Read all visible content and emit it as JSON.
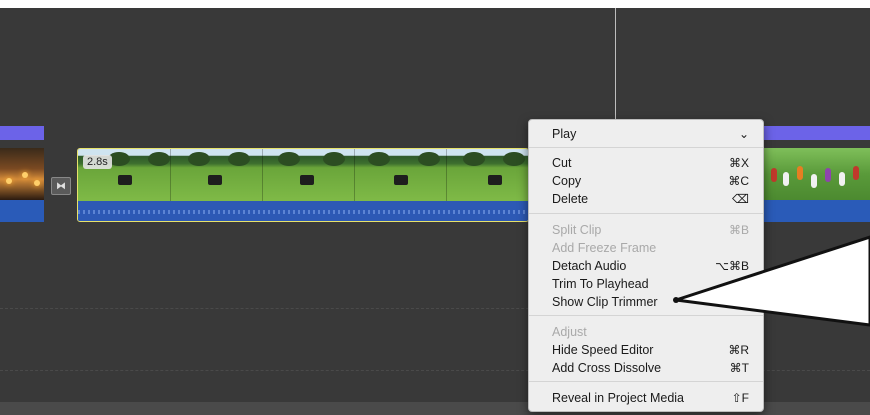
{
  "timeline": {
    "clip_duration": "2.8s",
    "transition_icon": "transition-icon"
  },
  "context_menu": {
    "items": [
      {
        "label": "Play",
        "shortcut": "⌄",
        "enabled": true
      },
      {
        "label": "Cut",
        "shortcut": "⌘X",
        "enabled": true
      },
      {
        "label": "Copy",
        "shortcut": "⌘C",
        "enabled": true
      },
      {
        "label": "Delete",
        "shortcut": "⌫",
        "enabled": true
      },
      {
        "label": "Split Clip",
        "shortcut": "⌘B",
        "enabled": false
      },
      {
        "label": "Add Freeze Frame",
        "shortcut": "",
        "enabled": false
      },
      {
        "label": "Detach Audio",
        "shortcut": "⌥⌘B",
        "enabled": true
      },
      {
        "label": "Trim To Playhead",
        "shortcut": "⌥/",
        "enabled": true
      },
      {
        "label": "Show Clip Trimmer",
        "shortcut": "⌘\\",
        "enabled": true
      },
      {
        "label": "Adjust",
        "shortcut": "",
        "enabled": false
      },
      {
        "label": "Hide Speed Editor",
        "shortcut": "⌘R",
        "enabled": true
      },
      {
        "label": "Add Cross Dissolve",
        "shortcut": "⌘T",
        "enabled": true
      },
      {
        "label": "Reveal in Project Media",
        "shortcut": "⇧F",
        "enabled": true
      }
    ]
  },
  "colors": {
    "timeline_bg": "#393939",
    "clip_border": "#e7e26a",
    "audio_band": "#2d59b5",
    "title_bar": "#6c63e8"
  }
}
